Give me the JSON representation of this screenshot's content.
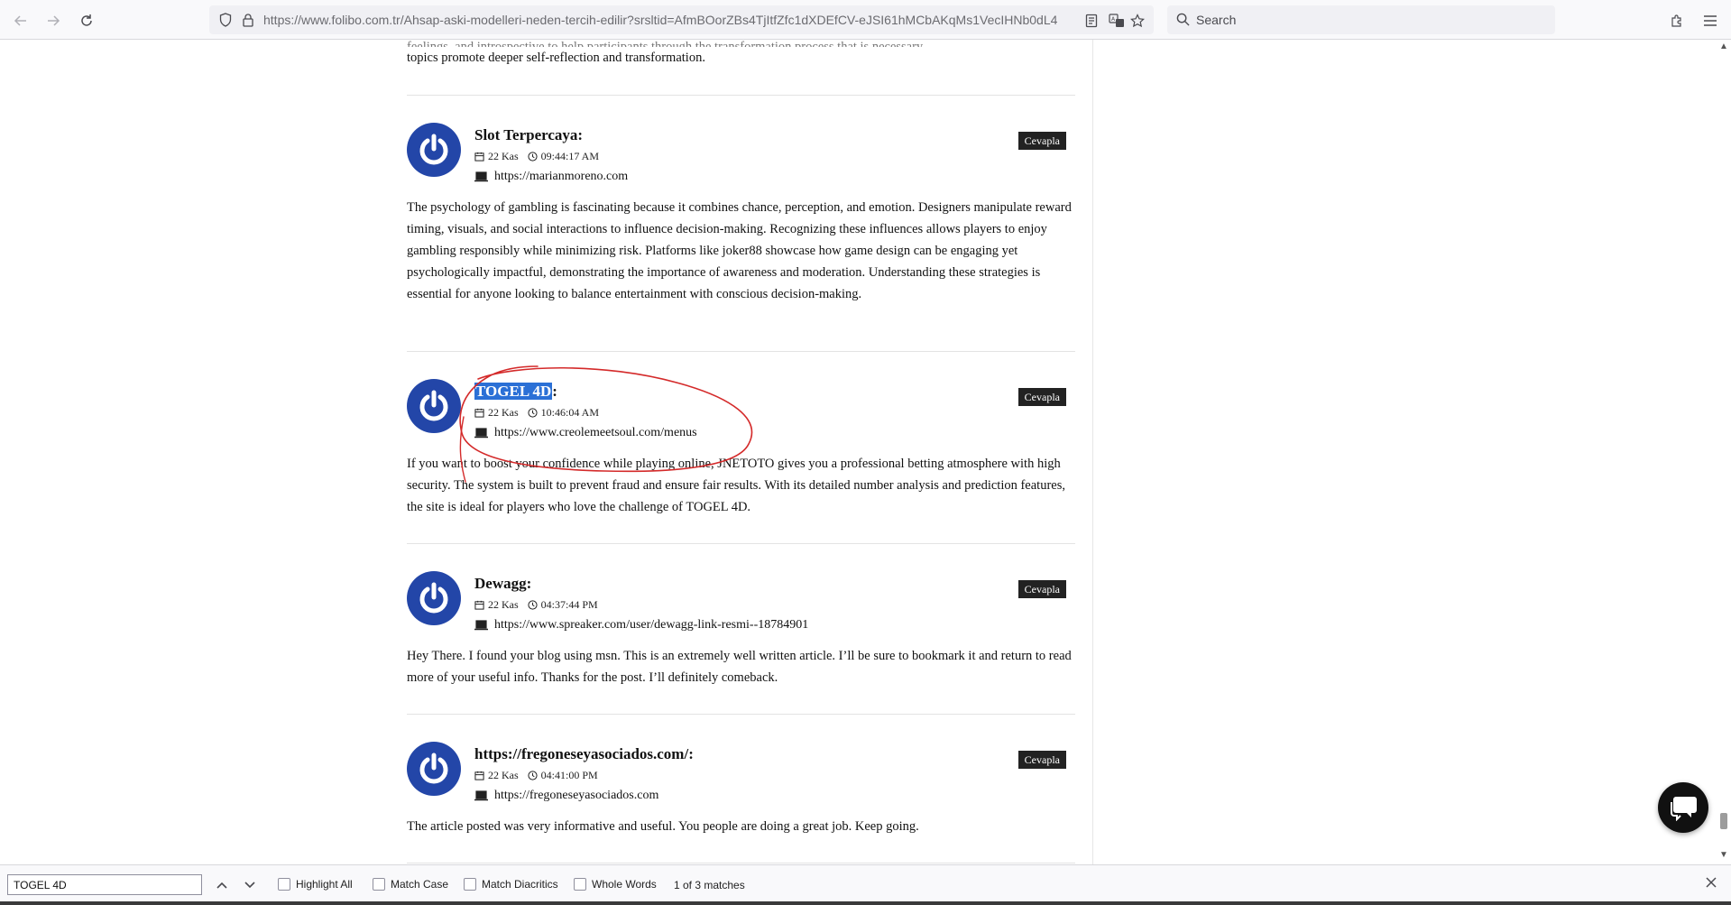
{
  "browser": {
    "url": "https://www.folibo.com.tr/Ahsap-aski-modelleri-neden-tercih-edilir?srsltid=AfmBOorZBs4TjItfZfc1dXDEfCV-eJSI61hMCbAKqMs1VecIHNb0dL4I",
    "search_placeholder": "Search"
  },
  "intro": {
    "cut_line": "feelings, and introspective to help participants through the transformation process that is necessary",
    "line": "topics promote deeper self-reflection and transformation."
  },
  "reply_label": "Cevapla",
  "comments": [
    {
      "author": "Slot Terpercaya:",
      "date": "22 Kas",
      "time": "09:44:17 AM",
      "website": "https://marianmoreno.com",
      "body": "The psychology of gambling is fascinating because it combines chance, perception, and emotion. Designers manipulate reward timing, visuals, and social interactions to influence decision-making. Recognizing these influences allows players to enjoy gambling responsibly while minimizing risk. Platforms like joker88 showcase how game design can be engaging yet psychologically impactful, demonstrating the importance of awareness and moderation. Understanding these strategies is essential for anyone looking to balance entertainment with conscious decision-making."
    },
    {
      "author_highlight": "TOGEL 4D",
      "author_suffix": ":",
      "date": "22 Kas",
      "time": "10:46:04 AM",
      "website": "https://www.creolemeetsoul.com/menus",
      "body": "If you want to boost your confidence while playing online, JNETOTO gives you a professional betting atmosphere with high security. The system is built to prevent fraud and ensure fair results. With its detailed number analysis and prediction features, the site is ideal for players who love the challenge of TOGEL 4D."
    },
    {
      "author": "Dewagg:",
      "date": "22 Kas",
      "time": "04:37:44 PM",
      "website": "https://www.spreaker.com/user/dewagg-link-resmi--18784901",
      "body": "Hey There. I found your blog using msn. This is an extremely well written article. I’ll be sure to bookmark it and return to read more of your useful info. Thanks for the post. I’ll definitely comeback."
    },
    {
      "author": "https://fregoneseyasociados.com/:",
      "date": "22 Kas",
      "time": "04:41:00 PM",
      "website": "https://fregoneseyasociados.com",
      "body": "The article posted was very informative and useful. You people are doing a great job. Keep going."
    }
  ],
  "findbar": {
    "query": "TOGEL 4D",
    "highlight_all": "Highlight All",
    "match_case": "Match Case",
    "match_diacritics": "Match Diacritics",
    "whole_words": "Whole Words",
    "status": "1 of 3 matches"
  },
  "colors": {
    "avatar": "#2346a8",
    "find_highlight": "#2b70d6",
    "annotation": "#d42a2a",
    "reply_bg": "#222222"
  }
}
